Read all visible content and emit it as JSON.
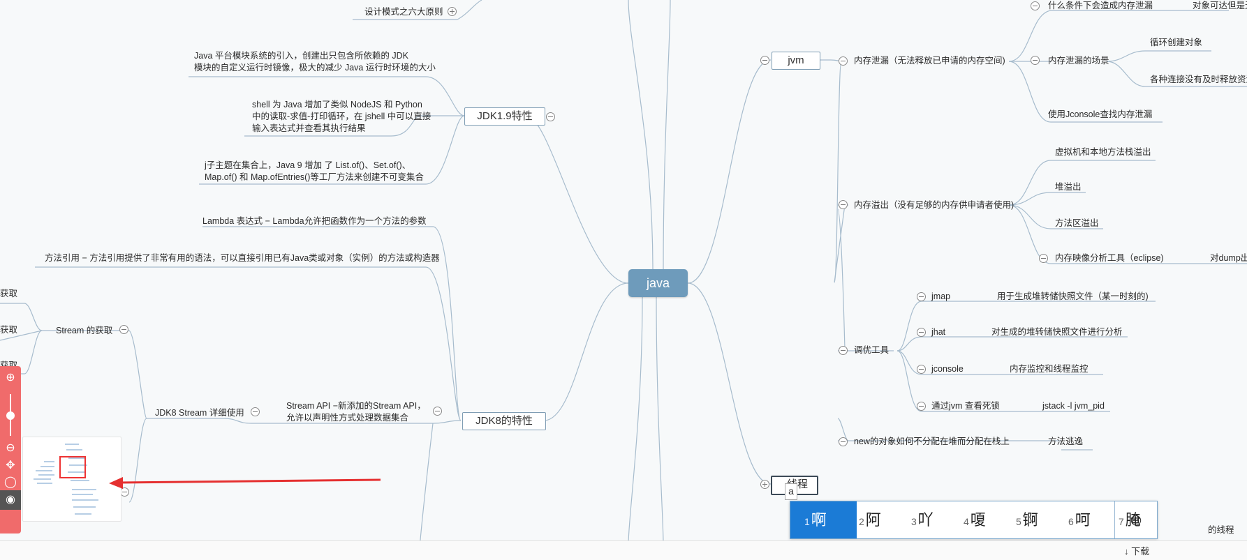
{
  "root": {
    "label": "java"
  },
  "left": {
    "design_principles": "设计模式之六大原则",
    "jdk19": {
      "label": "JDK1.9特性",
      "items": [
        "Java 平台模块系统的引入，创建出只包含所依赖的 JDK\n模块的自定义运行时镜像，极大的减少 Java 运行时环境的大小",
        "shell 为 Java 增加了类似 NodeJS 和 Python\n中的读取-求值-打印循环，在 jshell 中可以直接\n输入表达式并查看其执行结果",
        "j子主题在集合上，Java 9 增加 了 List.of()、Set.of()、\nMap.of() 和 Map.ofEntries()等工厂方法来创建不可变集合"
      ]
    },
    "jdk8": {
      "label": "JDK8的特性",
      "lambda": "Lambda 表达式 − Lambda允许把函数作为一个方法的参数",
      "method_ref": "方法引用 − 方法引用提供了非常有用的语法，可以直接引用已有Java类或对象（实例）的方法或构造器",
      "stream_api": "Stream API −新添加的Stream API，\n允许以声明性方式处理数据集合",
      "stream_usage": "JDK8 Stream 详细使用",
      "stream_get": "Stream 的获取",
      "partial": [
        "获取",
        "获取",
        "获取"
      ]
    }
  },
  "right": {
    "jvm": {
      "label": "jvm",
      "leak": {
        "label": "内存泄漏（无法释放已申请的内存空间)",
        "cause": "什么条件下会造成内存泄漏",
        "cause_detail": "对象可达但是无",
        "scenes": "内存泄漏的场景",
        "scene_items": [
          "循环创建对象",
          "各种连接没有及时释放资源"
        ],
        "jconsole": "使用Jconsole查找内存泄漏"
      },
      "overflow": {
        "label": "内存溢出（没有足够的内存供申请者使用)",
        "items": [
          "虚拟机和本地方法栈溢出",
          "堆溢出",
          "方法区溢出"
        ],
        "analysis": "内存映像分析工具（eclipse)",
        "analysis_detail": "对dump出"
      },
      "tuning": {
        "label": "调优工具",
        "tools": [
          {
            "name": "jmap",
            "desc": "用于生成堆转储快照文件（某一时刻的)"
          },
          {
            "name": "jhat",
            "desc": "对生成的堆转储快照文件进行分析"
          },
          {
            "name": "jconsole",
            "desc": "内存监控和线程监控"
          },
          {
            "name": "通过jvm 查看死锁",
            "desc": "jstack -l jvm_pid"
          }
        ]
      },
      "stack_alloc": {
        "label": "new的对象如何不分配在堆而分配在栈上",
        "detail": "方法逃逸"
      }
    },
    "thread": {
      "label": "线程"
    },
    "thread_partial": "的线程"
  },
  "ime": {
    "input": "a",
    "candidates": [
      {
        "num": "1",
        "char": "啊"
      },
      {
        "num": "2",
        "char": "阿"
      },
      {
        "num": "3",
        "char": "吖"
      },
      {
        "num": "4",
        "char": "嗄"
      },
      {
        "num": "5",
        "char": "锕"
      },
      {
        "num": "6",
        "char": "呵"
      },
      {
        "num": "7",
        "char": "腌"
      }
    ],
    "emoji": "☺"
  },
  "bottom": {
    "download": "下载"
  },
  "toolbar": {
    "icons": [
      "zoom-in",
      "zoom-out",
      "move",
      "fit",
      "eye"
    ]
  },
  "colors": {
    "root": "#6e9bbb",
    "toolbar": "#f06b6b",
    "ime_selected": "#1b7bd6",
    "arrow": "#e53030"
  }
}
